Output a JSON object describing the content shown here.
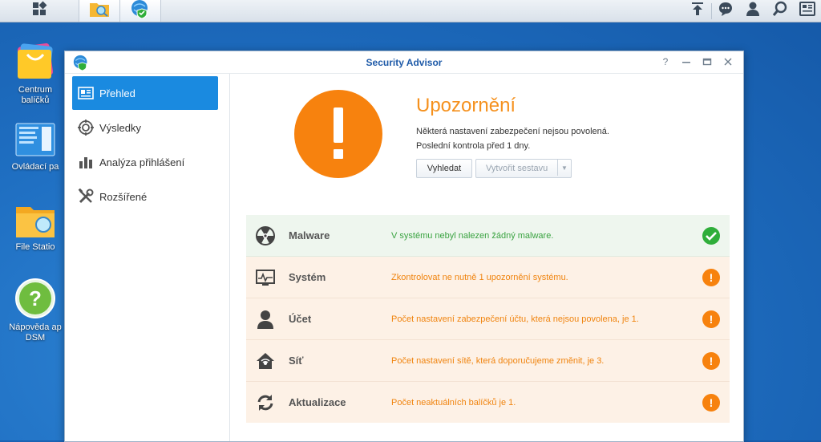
{
  "taskbar": {
    "icons_left": [
      "main-menu-icon",
      "file-station-icon",
      "security-advisor-icon"
    ],
    "icons_right": [
      "upload-icon",
      "chat-icon",
      "user-icon",
      "search-icon",
      "widgets-icon"
    ]
  },
  "desktop": {
    "items": [
      {
        "label": "Centrum\nbalíčků",
        "icon": "package-center-icon"
      },
      {
        "label": "Ovládací pa",
        "icon": "control-panel-icon"
      },
      {
        "label": "File Statio",
        "icon": "file-station-icon"
      },
      {
        "label": "Nápověda ap\nDSM",
        "icon": "help-icon"
      }
    ]
  },
  "window": {
    "title": "Security Advisor",
    "controls": [
      "help",
      "minimize",
      "maximize",
      "close"
    ]
  },
  "sidebar": {
    "items": [
      {
        "label": "Přehled",
        "icon": "overview-icon",
        "active": true
      },
      {
        "label": "Výsledky",
        "icon": "results-icon",
        "active": false
      },
      {
        "label": "Analýza přihlášení",
        "icon": "chart-icon",
        "active": false
      },
      {
        "label": "Rozšířené",
        "icon": "tools-icon",
        "active": false
      }
    ]
  },
  "status": {
    "title": "Upozornění",
    "line1": "Některá nastavení zabezpečení nejsou povolená.",
    "line2": "Poslední kontrola před 1 dny.",
    "scan_button": "Vyhledat",
    "report_button": "Vytvořit sestavu",
    "accent": "#f7820e"
  },
  "categories": [
    {
      "name": "Malware",
      "desc": "V systému nebyl nalezen žádný malware.",
      "state": "ok",
      "icon": "radiation-icon"
    },
    {
      "name": "Systém",
      "desc": "Zkontrolovat ne nutně 1 upozornění systému.",
      "state": "warn",
      "icon": "system-monitor-icon"
    },
    {
      "name": "Účet",
      "desc": "Počet nastavení zabezpečení účtu, která nejsou povolena, je 1.",
      "state": "warn",
      "icon": "account-icon"
    },
    {
      "name": "Síť",
      "desc": "Počet nastavení sítě, která doporučujeme změnit, je 3.",
      "state": "warn",
      "icon": "network-home-icon"
    },
    {
      "name": "Aktualizace",
      "desc": "Počet neaktuálních balíčků je 1.",
      "state": "warn",
      "icon": "update-icon"
    }
  ],
  "colors": {
    "ok": "#2fae3a",
    "warn": "#f7820e",
    "active_nav": "#1a8ae0"
  }
}
